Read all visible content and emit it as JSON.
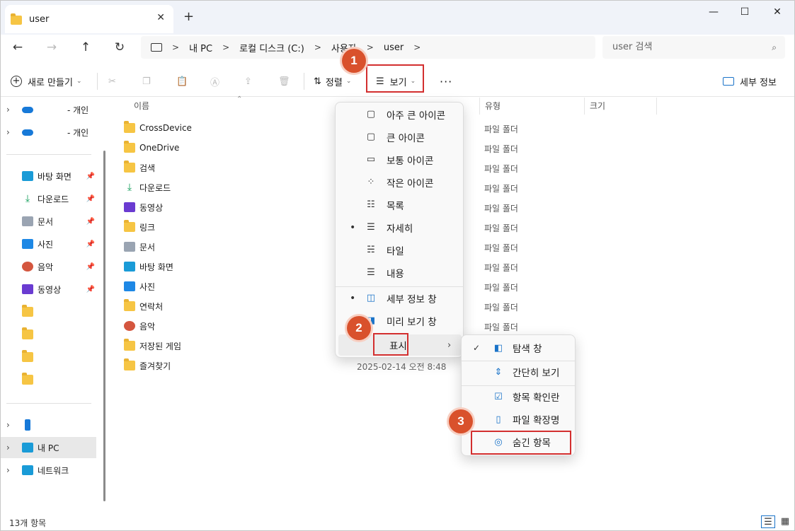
{
  "window": {
    "tab_title": "user",
    "close_tab": "✕",
    "new_tab": "+",
    "minimize": "—",
    "maximize": "☐",
    "close": "✕"
  },
  "nav": {
    "back": "←",
    "forward": "→",
    "up": "↑",
    "refresh": "↻",
    "breadcrumb": [
      "내 PC",
      "로컬 디스크 (C:)",
      "사용자",
      "user"
    ],
    "search_placeholder": "user 검색"
  },
  "toolbar": {
    "new_label": "새로 만들기",
    "sort_label": "정렬",
    "view_label": "보기",
    "more": "···",
    "details_pane_label": "세부 정보"
  },
  "sidebar": {
    "top_items": [
      {
        "label": "- 개인",
        "icon": "cloud-icon"
      },
      {
        "label": "- 개인",
        "icon": "cloud-icon"
      }
    ],
    "quick_access": [
      {
        "label": "바탕 화면",
        "icon": "desktop-icon"
      },
      {
        "label": "다운로드",
        "icon": "download-icon"
      },
      {
        "label": "문서",
        "icon": "document-icon"
      },
      {
        "label": "사진",
        "icon": "pictures-icon"
      },
      {
        "label": "음악",
        "icon": "music-icon"
      },
      {
        "label": "동영상",
        "icon": "video-icon"
      }
    ],
    "bottom_items": [
      {
        "label": "",
        "icon": "phone-icon"
      },
      {
        "label": "내 PC",
        "icon": "pc-icon"
      },
      {
        "label": "네트워크",
        "icon": "network-icon"
      }
    ]
  },
  "columns": {
    "name": "이름",
    "type": "유형",
    "size": "크기"
  },
  "files": [
    {
      "name": "CrossDevice",
      "icon": "folder-icon",
      "type": "파일 폴더"
    },
    {
      "name": "OneDrive",
      "icon": "folder-icon",
      "type": "파일 폴더"
    },
    {
      "name": "검색",
      "icon": "folder-icon",
      "type": "파일 폴더"
    },
    {
      "name": "다운로드",
      "icon": "download-icon",
      "type": "파일 폴더"
    },
    {
      "name": "동영상",
      "icon": "video-icon",
      "type": "파일 폴더"
    },
    {
      "name": "링크",
      "icon": "folder-icon",
      "type": "파일 폴더"
    },
    {
      "name": "문서",
      "icon": "document-icon",
      "type": "파일 폴더"
    },
    {
      "name": "바탕 화면",
      "icon": "desktop-icon",
      "type": "파일 폴더"
    },
    {
      "name": "사진",
      "icon": "pictures-icon",
      "type": "파일 폴더"
    },
    {
      "name": "연락처",
      "icon": "folder-icon",
      "type": "파일 폴더"
    },
    {
      "name": "음악",
      "icon": "music-icon",
      "type": "파일 폴더"
    },
    {
      "name": "저장된 게임",
      "icon": "folder-icon",
      "type": ""
    },
    {
      "name": "즐겨찾기",
      "icon": "folder-icon",
      "type": ""
    }
  ],
  "visible_date": "2025-02-14 오전 8:48",
  "view_menu": {
    "items": [
      {
        "label": "아주 큰 아이콘",
        "icon": "extra-large-icons-icon",
        "selected": false
      },
      {
        "label": "큰 아이콘",
        "icon": "large-icons-icon",
        "selected": false
      },
      {
        "label": "보통 아이콘",
        "icon": "medium-icons-icon",
        "selected": false
      },
      {
        "label": "작은 아이콘",
        "icon": "small-icons-icon",
        "selected": false
      },
      {
        "label": "목록",
        "icon": "list-icon",
        "selected": false
      },
      {
        "label": "자세히",
        "icon": "details-icon",
        "selected": true
      },
      {
        "label": "타일",
        "icon": "tiles-icon",
        "selected": false
      },
      {
        "label": "내용",
        "icon": "content-icon",
        "selected": false
      }
    ],
    "pane_items": [
      {
        "label": "세부 정보 창",
        "icon": "details-pane-icon",
        "selected": true
      },
      {
        "label": "미리 보기 창",
        "icon": "preview-pane-icon",
        "selected": false
      }
    ],
    "show_label": "표시"
  },
  "show_submenu": [
    {
      "label": "탐색 창",
      "icon": "navigation-pane-icon",
      "checked": true
    },
    {
      "label": "간단히 보기",
      "icon": "compact-view-icon",
      "checked": false
    },
    {
      "label": "항목 확인란",
      "icon": "checkbox-icon",
      "checked": false
    },
    {
      "label": "파일 확장명",
      "icon": "file-extension-icon",
      "checked": false
    },
    {
      "label": "숨긴 항목",
      "icon": "eye-icon",
      "checked": false
    }
  ],
  "badges": [
    "1",
    "2",
    "3"
  ],
  "status": {
    "count": "13개 항목"
  },
  "colors": {
    "highlight_red": "#d32f2f",
    "badge_orange": "#d9512c",
    "folder_yellow": "#f6c544"
  }
}
